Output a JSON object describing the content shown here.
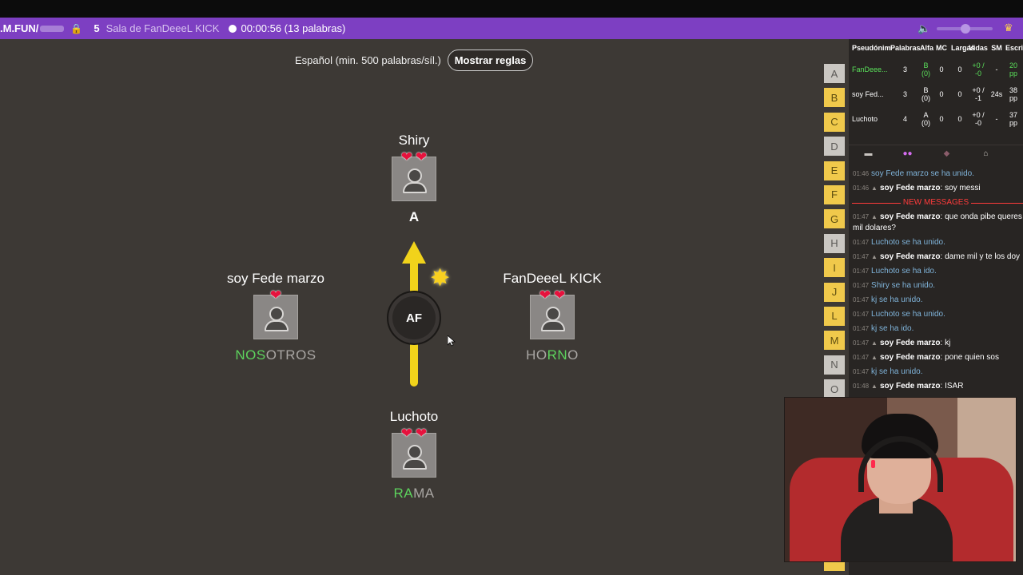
{
  "topbar": {
    "site": ".M.FUN/",
    "room_number": "5",
    "room_name": "Sala de FanDeeeL KICK",
    "timer": "00:00:56 (13 palabras)"
  },
  "header": {
    "language": "Español (min. 500 palabras/síl.)",
    "rules_button": "Mostrar reglas"
  },
  "players": {
    "top": {
      "name": "Shiry",
      "hearts": 2,
      "letter": "A"
    },
    "left": {
      "name": "soy Fede marzo",
      "hearts": 1,
      "word_ok": "NOS",
      "word_rest": "OTROS"
    },
    "right": {
      "name": "FanDeeeL KICK",
      "hearts": 2,
      "word_ok": "",
      "word_rest_a": "HO",
      "word_ok_mid": "RN",
      "word_rest_b": "O"
    },
    "bottom": {
      "name": "Luchoto",
      "hearts": 2,
      "word_ok": "RA",
      "word_rest": "MA"
    }
  },
  "bomb": {
    "syllable": "AF"
  },
  "letters": [
    {
      "l": "A",
      "used": true
    },
    {
      "l": "B",
      "used": false
    },
    {
      "l": "C",
      "used": false
    },
    {
      "l": "D",
      "used": true
    },
    {
      "l": "E",
      "used": false
    },
    {
      "l": "F",
      "used": false
    },
    {
      "l": "G",
      "used": false
    },
    {
      "l": "H",
      "used": true
    },
    {
      "l": "I",
      "used": false
    },
    {
      "l": "J",
      "used": false
    },
    {
      "l": "L",
      "used": false
    },
    {
      "l": "M",
      "used": false
    },
    {
      "l": "N",
      "used": true
    },
    {
      "l": "O",
      "used": true
    }
  ],
  "table": {
    "headers": [
      "Pseudónimo",
      "Palabras",
      "Alfa",
      "MC",
      "Largas",
      "Vidas",
      "SM",
      "Escri"
    ],
    "rows": [
      {
        "name": "FanDeee...",
        "palabras": "3",
        "alfa": "B (0)",
        "mc": "0",
        "largas": "0",
        "vidas": "+0 / -0",
        "sm": "-",
        "escri": "20 pp"
      },
      {
        "name": "soy Fed...",
        "palabras": "3",
        "alfa": "B (0)",
        "mc": "0",
        "largas": "0",
        "vidas": "+0 / -1",
        "sm": "24s",
        "escri": "38 pp"
      },
      {
        "name": "Luchoto",
        "palabras": "4",
        "alfa": "A (0)",
        "mc": "0",
        "largas": "0",
        "vidas": "+0 / -0",
        "sm": "-",
        "escri": "37 pp"
      }
    ]
  },
  "chat": {
    "new_messages_label": "NEW MESSAGES",
    "before": [
      {
        "ts": "01:46",
        "sys": true,
        "text": "soy Fede marzo se ha unido."
      },
      {
        "ts": "01:46",
        "sys": false,
        "user": "soy Fede marzo",
        "text": "soy messi"
      }
    ],
    "after": [
      {
        "ts": "01:47",
        "sys": false,
        "user": "soy Fede marzo",
        "text": "que onda pibe queres mil dolares?"
      },
      {
        "ts": "01:47",
        "sys": true,
        "text": "Luchoto se ha unido."
      },
      {
        "ts": "01:47",
        "sys": false,
        "user": "soy Fede marzo",
        "text": "dame mil y te los doy"
      },
      {
        "ts": "01:47",
        "sys": true,
        "text": "Luchoto se ha ido."
      },
      {
        "ts": "01:47",
        "sys": true,
        "text": "Shiry se ha unido."
      },
      {
        "ts": "01:47",
        "sys": true,
        "text": "kj se ha unido."
      },
      {
        "ts": "01:47",
        "sys": true,
        "text": "Luchoto se ha unido."
      },
      {
        "ts": "01:47",
        "sys": true,
        "text": "kj se ha ido."
      },
      {
        "ts": "01:47",
        "sys": false,
        "user": "soy Fede marzo",
        "text": "kj"
      },
      {
        "ts": "01:47",
        "sys": false,
        "user": "soy Fede marzo",
        "text": "pone quien sos"
      },
      {
        "ts": "01:47",
        "sys": true,
        "text": "kj se ha unido."
      },
      {
        "ts": "01:48",
        "sys": false,
        "user": "soy Fede marzo",
        "text": "ISAR"
      }
    ]
  },
  "colors": {
    "topbar": "#7d3fc2",
    "letter_active": "#f0c94b",
    "correct": "#5dd35d",
    "heart": "#e6123d"
  }
}
